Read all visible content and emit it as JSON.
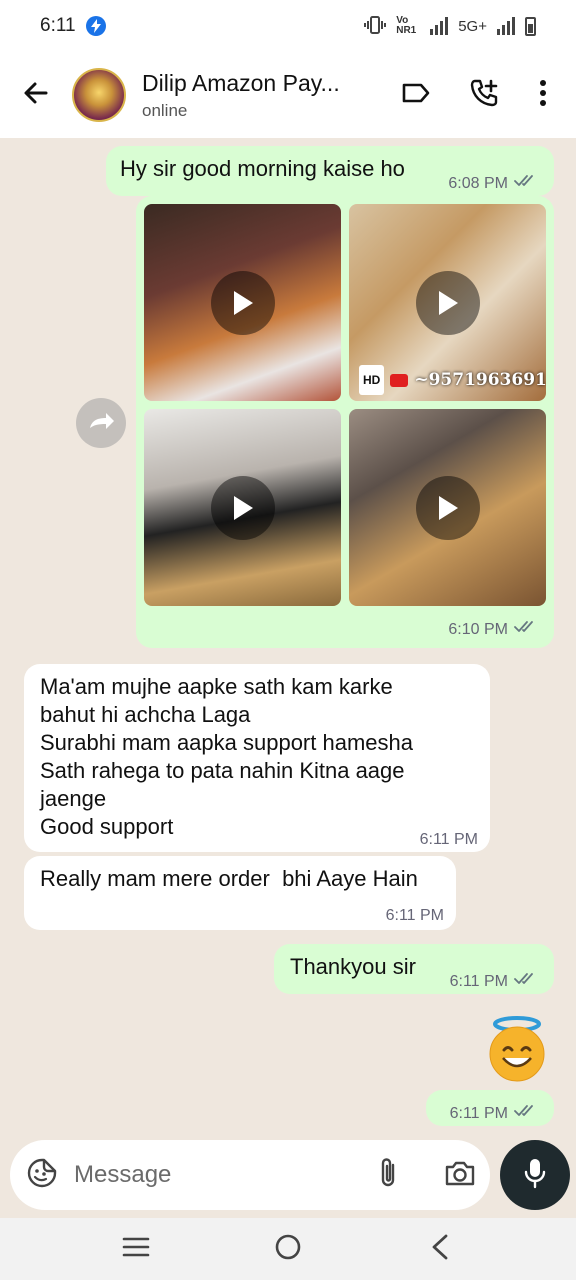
{
  "status_bar": {
    "time": "6:11",
    "network_label": "Vo NR1",
    "network_type": "5G+"
  },
  "header": {
    "contact_name": "Dilip Amazon Pay...",
    "contact_status": "online",
    "icons": [
      "back-arrow-icon",
      "label-icon",
      "add-call-icon",
      "more-vert-icon"
    ]
  },
  "messages": [
    {
      "direction": "outgoing",
      "text": "Hy sir good morning kaise ho",
      "time": "6:08 PM",
      "read": true
    },
    {
      "direction": "outgoing",
      "type": "media_album",
      "items": [
        {
          "kind": "video"
        },
        {
          "kind": "video",
          "overlay": "~9571963691",
          "badge": "HD"
        },
        {
          "kind": "video"
        },
        {
          "kind": "video"
        }
      ],
      "time": "6:10 PM",
      "read": true
    },
    {
      "direction": "incoming",
      "lines": [
        "Ma'am mujhe aapke sath kam karke",
        "bahut hi achcha Laga",
        "Surabhi mam aapka support hamesha",
        "Sath rahega to pata nahin Kitna aage",
        "jaenge",
        "Good support"
      ],
      "time": "6:11 PM"
    },
    {
      "direction": "incoming",
      "text": "Really mam mere order  bhi Aaye Hain",
      "time": "6:11 PM"
    },
    {
      "direction": "outgoing",
      "text": "Thankyou sir",
      "time": "6:11 PM",
      "read": true
    },
    {
      "direction": "outgoing",
      "type": "emoji",
      "emoji_name": "smiling-face-with-halo",
      "time": "6:11 PM",
      "read": true
    }
  ],
  "composer": {
    "placeholder": "Message"
  },
  "colors": {
    "outgoing_bubble": "#d9fdd3",
    "incoming_bubble": "#ffffff",
    "chat_background": "#efe7de",
    "read_ticks": "#667781",
    "mic_button": "#1f2a2e"
  }
}
